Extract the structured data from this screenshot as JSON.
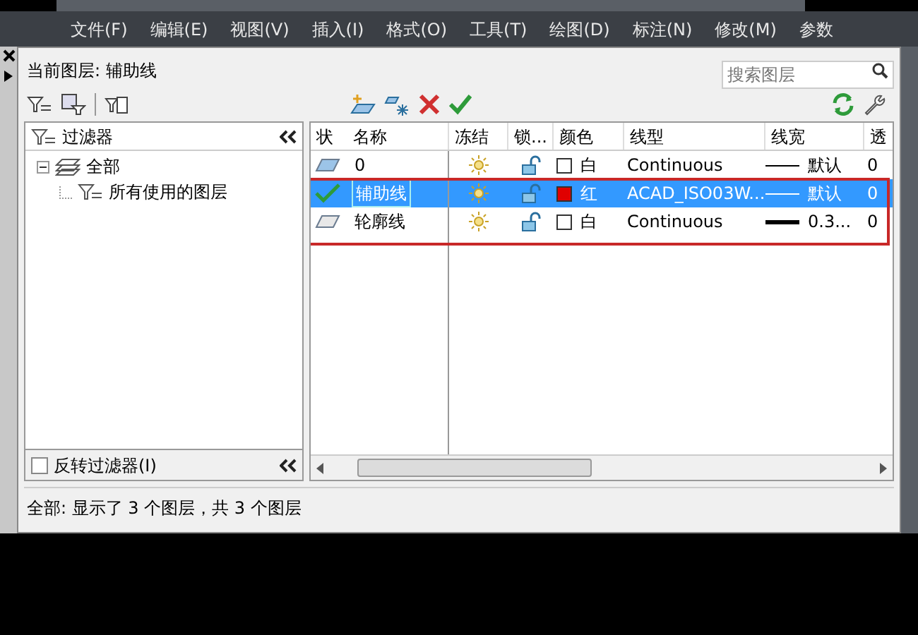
{
  "menu": [
    {
      "label": "文件(F)"
    },
    {
      "label": "编辑(E)"
    },
    {
      "label": "视图(V)"
    },
    {
      "label": "插入(I)"
    },
    {
      "label": "格式(O)"
    },
    {
      "label": "工具(T)"
    },
    {
      "label": "绘图(D)"
    },
    {
      "label": "标注(N)"
    },
    {
      "label": "修改(M)"
    },
    {
      "label": "参数"
    }
  ],
  "dialog": {
    "current_layer": "当前图层: 辅助线",
    "search": {
      "placeholder": "搜索图层"
    }
  },
  "filters": {
    "title": "过滤器",
    "tree": [
      {
        "label": "全部",
        "expanded": true,
        "children": [
          {
            "label": "所有使用的图层"
          }
        ]
      }
    ],
    "invert": {
      "label": "反转过滤器(I)",
      "checked": false
    }
  },
  "table": {
    "columns": [
      "状",
      "名称",
      "冻结",
      "锁...",
      "颜色",
      "线型",
      "线宽",
      "透"
    ],
    "rows": [
      {
        "kind": "used",
        "name": "0",
        "selected": false,
        "frozen": false,
        "locked": false,
        "color": "#ffffff",
        "color_name": "白",
        "linetype": "Continuous",
        "heavy": false,
        "lineweight": "默认",
        "transparency": "0"
      },
      {
        "kind": "current",
        "name": "辅助线",
        "selected": true,
        "frozen": false,
        "locked": false,
        "color": "#e00000",
        "color_name": "红",
        "linetype": "ACAD_ISO03W...",
        "heavy": false,
        "lineweight": "默认",
        "transparency": "0"
      },
      {
        "kind": "unused",
        "name": "轮廓线",
        "selected": false,
        "frozen": false,
        "locked": false,
        "color": "#ffffff",
        "color_name": "白",
        "linetype": "Continuous",
        "heavy": true,
        "lineweight": "0.3...",
        "transparency": "0"
      }
    ]
  },
  "status_bar": "全部: 显示了 3 个图层，共 3 个图层"
}
